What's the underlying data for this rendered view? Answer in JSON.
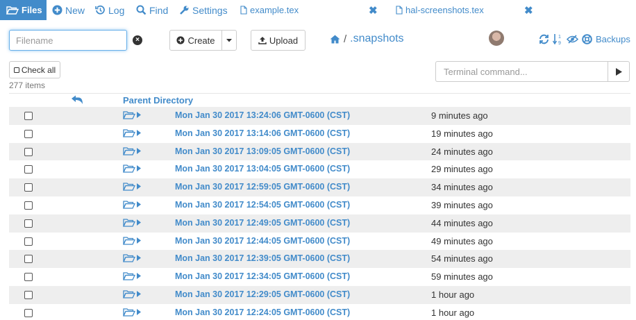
{
  "nav": {
    "files_label": "Files",
    "new_label": "New",
    "log_label": "Log",
    "find_label": "Find",
    "settings_label": "Settings",
    "tabs": [
      {
        "label": "example.tex"
      },
      {
        "label": "hal-screenshots.tex"
      }
    ]
  },
  "toolbar": {
    "filename_placeholder": "Filename",
    "create_label": "Create",
    "upload_label": "Upload",
    "path_separator": "/",
    "current_dir": ".snapshots",
    "backups_label": "Backups"
  },
  "list_controls": {
    "check_all_label": "Check all",
    "items_count": "277 items",
    "terminal_placeholder": "Terminal command..."
  },
  "listing": {
    "parent_label": "Parent Directory",
    "rows": [
      {
        "name": "Mon Jan 30 2017 13:24:06 GMT-0600 (CST)",
        "time": "9 minutes ago"
      },
      {
        "name": "Mon Jan 30 2017 13:14:06 GMT-0600 (CST)",
        "time": "19 minutes ago"
      },
      {
        "name": "Mon Jan 30 2017 13:09:05 GMT-0600 (CST)",
        "time": "24 minutes ago"
      },
      {
        "name": "Mon Jan 30 2017 13:04:05 GMT-0600 (CST)",
        "time": "29 minutes ago"
      },
      {
        "name": "Mon Jan 30 2017 12:59:05 GMT-0600 (CST)",
        "time": "34 minutes ago"
      },
      {
        "name": "Mon Jan 30 2017 12:54:05 GMT-0600 (CST)",
        "time": "39 minutes ago"
      },
      {
        "name": "Mon Jan 30 2017 12:49:05 GMT-0600 (CST)",
        "time": "44 minutes ago"
      },
      {
        "name": "Mon Jan 30 2017 12:44:05 GMT-0600 (CST)",
        "time": "49 minutes ago"
      },
      {
        "name": "Mon Jan 30 2017 12:39:05 GMT-0600 (CST)",
        "time": "54 minutes ago"
      },
      {
        "name": "Mon Jan 30 2017 12:34:05 GMT-0600 (CST)",
        "time": "59 minutes ago"
      },
      {
        "name": "Mon Jan 30 2017 12:29:05 GMT-0600 (CST)",
        "time": "1 hour ago"
      },
      {
        "name": "Mon Jan 30 2017 12:24:05 GMT-0600 (CST)",
        "time": "1 hour ago"
      }
    ]
  },
  "colors": {
    "accent": "#428bca",
    "row_stripe": "#eeeeee"
  }
}
